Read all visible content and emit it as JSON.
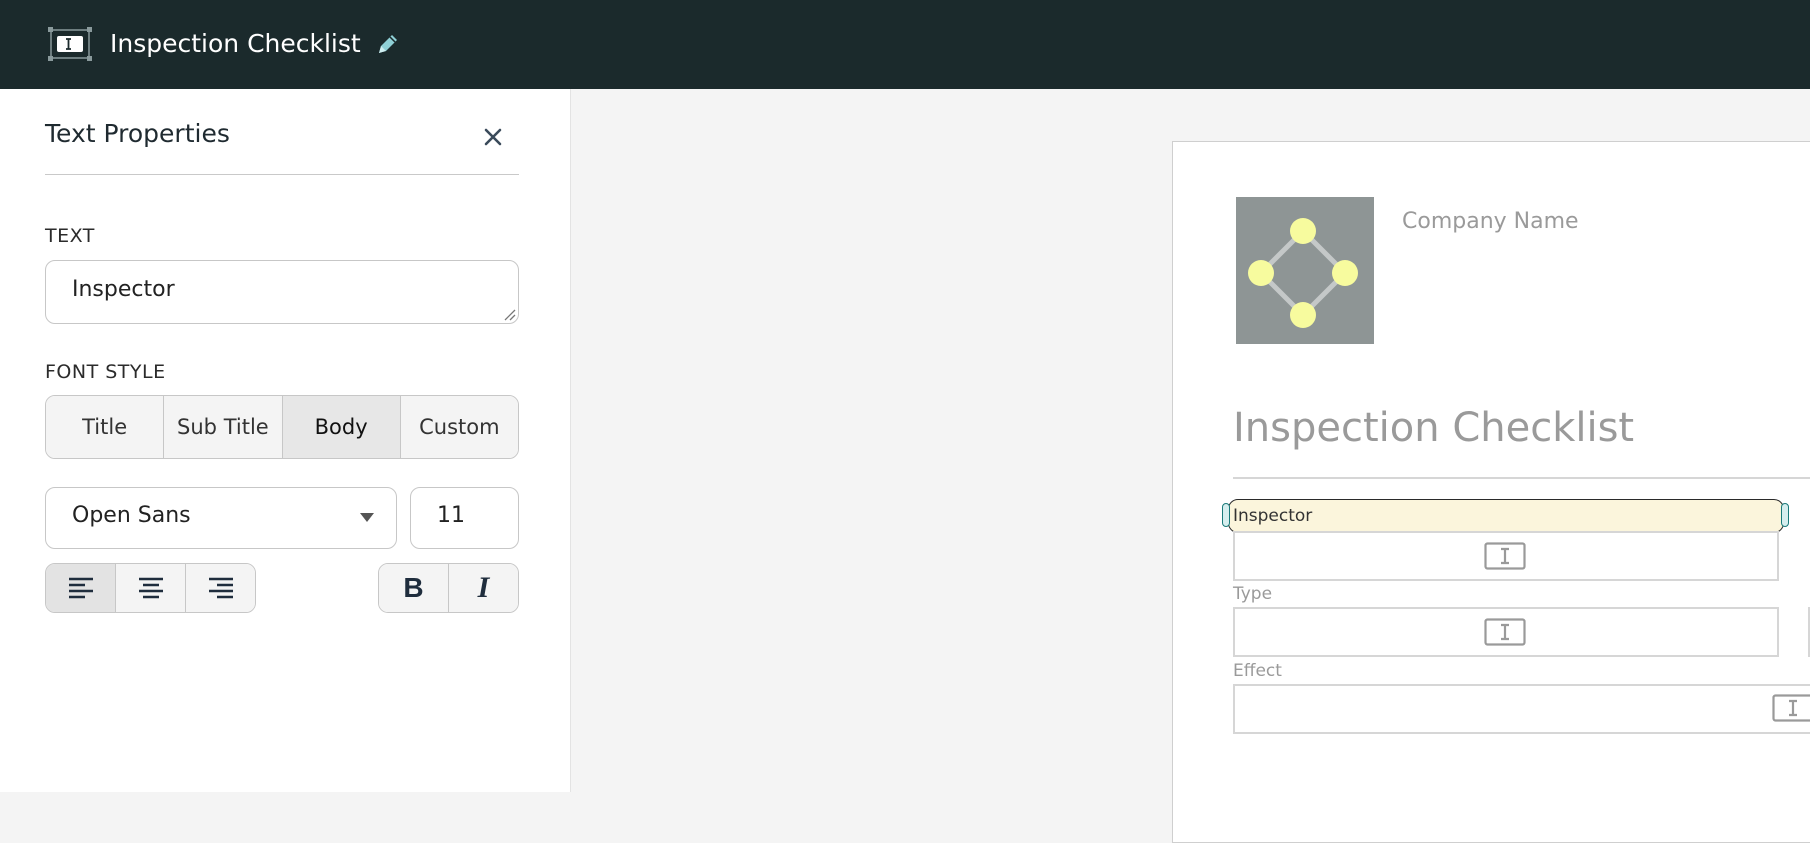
{
  "header": {
    "title": "Inspection Checklist",
    "app_icon": "text-field-icon",
    "edit_icon": "pencil-icon"
  },
  "panel": {
    "title": "Text Properties",
    "close_icon": "close-icon",
    "text_section_label": "TEXT",
    "text_value": "Inspector",
    "font_style_label": "FONT STYLE",
    "font_styles": [
      "Title",
      "Sub Title",
      "Body",
      "Custom"
    ],
    "active_font_style": "Body",
    "font_family": "Open Sans",
    "font_size": "11",
    "alignment_active": "left",
    "bold_label": "B",
    "italic_label": "I"
  },
  "document": {
    "company_name": "Company Name",
    "title": "Inspection Checklist",
    "selected_field_text": "Inspector",
    "field_labels": [
      "Type",
      "Effect"
    ]
  },
  "colors": {
    "header_bg": "#1b2a2c",
    "accent_teal": "#8fd0d6",
    "logo_bg": "#8e9595",
    "logo_node": "#f7fb9e",
    "selection_bg": "#fbf5dc"
  }
}
